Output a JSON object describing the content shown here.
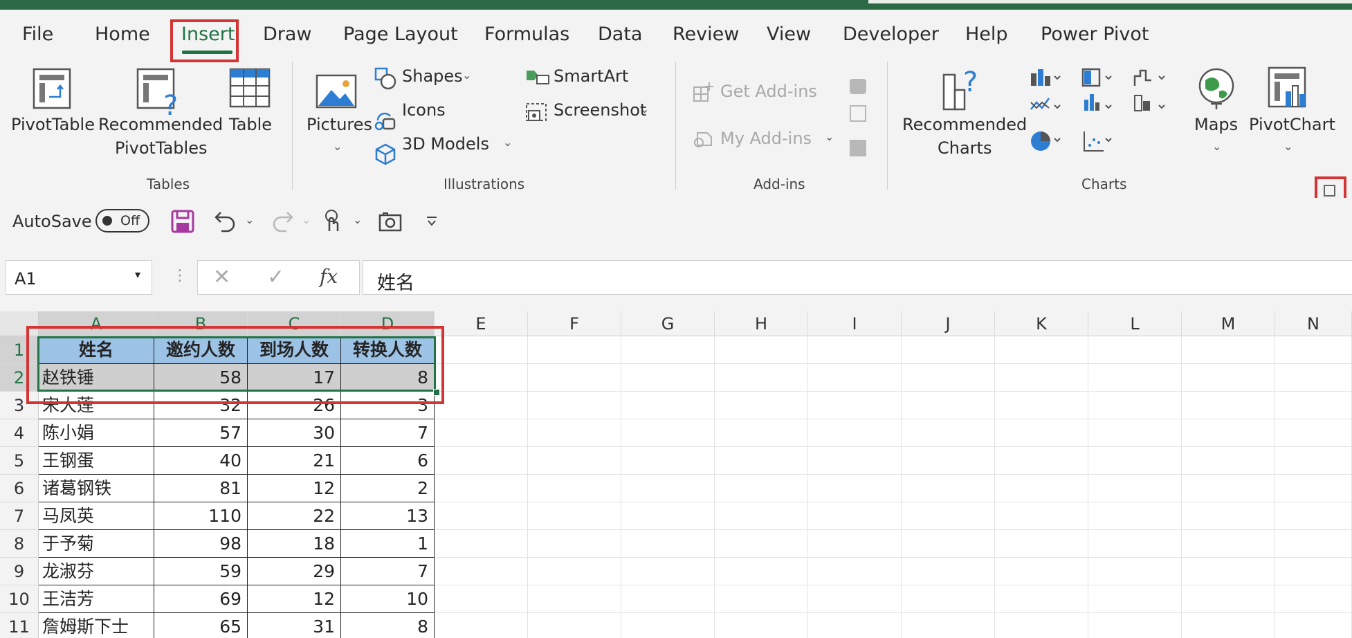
{
  "ribbon": {
    "tabs": [
      "File",
      "Home",
      "Insert",
      "Draw",
      "Page Layout",
      "Formulas",
      "Data",
      "Review",
      "View",
      "Developer",
      "Help",
      "Power Pivot"
    ],
    "tables": {
      "pivottable": "PivotTable",
      "recommended_line1": "Recommended",
      "recommended_line2": "PivotTables",
      "table": "Table",
      "group": "Tables"
    },
    "illustrations": {
      "pictures": "Pictures",
      "shapes": "Shapes",
      "icons": "Icons",
      "models": "3D Models",
      "smartart": "SmartArt",
      "screenshot": "Screenshot",
      "group": "Illustrations"
    },
    "addins": {
      "get": "Get Add-ins",
      "my": "My Add-ins",
      "group": "Add-ins"
    },
    "charts": {
      "recommended_line1": "Recommended",
      "recommended_line2": "Charts",
      "maps": "Maps",
      "pivotchart": "PivotChart",
      "group": "Charts"
    }
  },
  "qat": {
    "autosave": "AutoSave",
    "toggle": "Off"
  },
  "formula_bar": {
    "name_box": "A1",
    "fx": "fx",
    "formula": "姓名"
  },
  "grid": {
    "columns": [
      "A",
      "B",
      "C",
      "D",
      "E",
      "F",
      "G",
      "H",
      "I",
      "J",
      "K",
      "L",
      "M",
      "N"
    ],
    "rows": [
      "1",
      "2",
      "3",
      "4",
      "5",
      "6",
      "7",
      "8",
      "9",
      "10",
      "11"
    ],
    "table_header": [
      "姓名",
      "邀约人数",
      "到场人数",
      "转换人数"
    ],
    "table_rows": [
      [
        "赵铁锤",
        "58",
        "17",
        "8"
      ],
      [
        "宋大莲",
        "32",
        "26",
        "3"
      ],
      [
        "陈小娟",
        "57",
        "30",
        "7"
      ],
      [
        "王钢蛋",
        "40",
        "21",
        "6"
      ],
      [
        "诸葛钢铁",
        "81",
        "12",
        "2"
      ],
      [
        "马凤英",
        "110",
        "22",
        "13"
      ],
      [
        "于予菊",
        "98",
        "18",
        "1"
      ],
      [
        "龙淑芬",
        "59",
        "29",
        "7"
      ],
      [
        "王洁芳",
        "69",
        "12",
        "10"
      ],
      [
        "詹姆斯下士",
        "65",
        "31",
        "8"
      ]
    ]
  },
  "colors": {
    "accent_green": "#217346",
    "highlight_red": "#d33434",
    "header_blue": "#9cc2e5"
  }
}
